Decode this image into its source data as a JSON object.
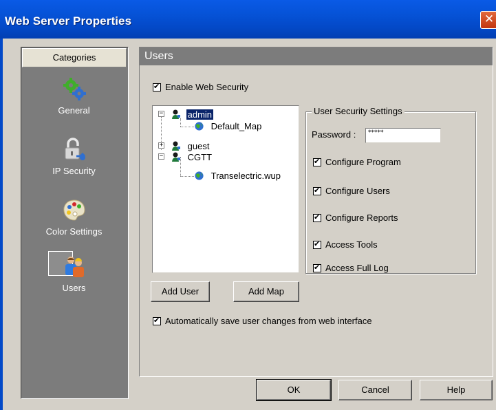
{
  "window": {
    "title": "Web Server Properties",
    "close_glyph": "✕"
  },
  "sidebar": {
    "header": "Categories",
    "items": [
      {
        "label": "General",
        "icon": "gears-icon"
      },
      {
        "label": "IP Security",
        "icon": "padlock-icon"
      },
      {
        "label": "Color Settings",
        "icon": "palette-icon"
      },
      {
        "label": "Users",
        "icon": "users-icon",
        "selected": true
      }
    ]
  },
  "panel": {
    "title": "Users",
    "enable_security": {
      "label": "Enable Web Security",
      "checked": true
    },
    "tree": [
      {
        "label": "admin",
        "type": "user",
        "expanded": true,
        "selected": true
      },
      {
        "label": "Default_Map",
        "type": "map",
        "parent": "admin"
      },
      {
        "label": "guest",
        "type": "user",
        "expanded": false
      },
      {
        "label": "CGTT",
        "type": "user",
        "expanded": true
      },
      {
        "label": "Transelectric.wup",
        "type": "map",
        "parent": "CGTT"
      }
    ],
    "security_settings": {
      "title": "User Security Settings",
      "password_label": "Password :",
      "password_value": "*****",
      "options": [
        {
          "label": "Configure Program",
          "checked": true
        },
        {
          "label": "Configure Users",
          "checked": true
        },
        {
          "label": "Configure Reports",
          "checked": true
        },
        {
          "label": "Access Tools",
          "checked": true
        },
        {
          "label": "Access Full Log",
          "checked": true
        }
      ]
    },
    "add_user_label": "Add User",
    "add_map_label": "Add Map",
    "autosave": {
      "label": "Automatically save user changes from web interface",
      "checked": true
    }
  },
  "footer": {
    "ok_label": "OK",
    "cancel_label": "Cancel",
    "help_label": "Help"
  },
  "colors": {
    "titlebar": "#0349c8",
    "sidebar": "#7c7c7c",
    "dialog": "#d4d0c8",
    "selection": "#0a246a"
  }
}
